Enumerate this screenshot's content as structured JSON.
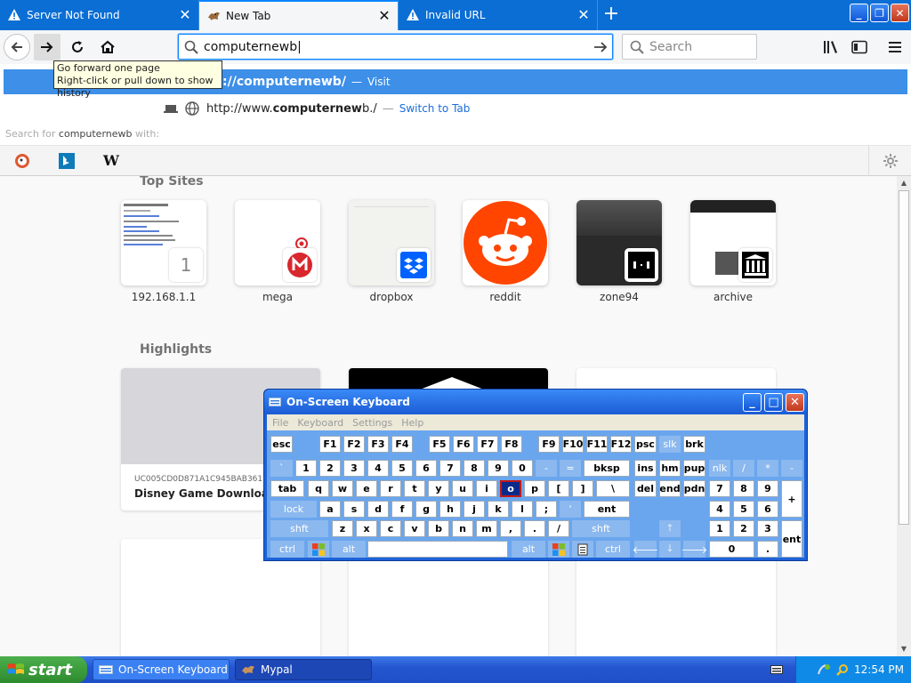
{
  "tabs": [
    {
      "title": "Server Not Found",
      "icon": "warning-icon",
      "active": false
    },
    {
      "title": "New Tab",
      "icon": "mypal-icon",
      "active": true
    },
    {
      "title": "Invalid URL",
      "icon": "warning-icon",
      "active": false
    }
  ],
  "urlbar": {
    "value": "computernewb|"
  },
  "searchbar": {
    "placeholder": "Search"
  },
  "tooltip": {
    "line1": "Go forward one page",
    "line2": "Right-click or pull down to show history"
  },
  "dropdown": {
    "row1_url": "://computernewb/",
    "row1_sep": "—",
    "row1_action": "Visit",
    "row2_url_prefix": "http://www.",
    "row2_url_bold": "computernew",
    "row2_url_suffix": "b./",
    "row2_sep": "—",
    "row2_action": "Switch to Tab",
    "search_for_prefix": "Search for",
    "search_for_term": "computernewb",
    "search_for_suffix": "with:",
    "engines": [
      "duckduckgo-icon",
      "bing-icon",
      "wikipedia-icon"
    ]
  },
  "top_sites": {
    "title": "Top Sites",
    "sites": [
      {
        "label": "192.168.1.1",
        "badge": "1"
      },
      {
        "label": "mega"
      },
      {
        "label": "dropbox"
      },
      {
        "label": "reddit"
      },
      {
        "label": "zone94"
      },
      {
        "label": "archive"
      }
    ]
  },
  "highlights": {
    "title": "Highlights",
    "card1_id": "UC005CD0D871A1C945BAB3617D",
    "card1_title": "Disney Game Downloads.z"
  },
  "osk": {
    "title": "On-Screen Keyboard",
    "menu": [
      "File",
      "Keyboard",
      "Settings",
      "Help"
    ],
    "row1": [
      "esc",
      "F1",
      "F2",
      "F3",
      "F4",
      "F5",
      "F6",
      "F7",
      "F8",
      "F9",
      "F10",
      "F11",
      "F12",
      "psc",
      "slk",
      "brk"
    ],
    "row2": [
      "`",
      "1",
      "2",
      "3",
      "4",
      "5",
      "6",
      "7",
      "8",
      "9",
      "0",
      "-",
      "=",
      "bksp",
      "ins",
      "hm",
      "pup",
      "nlk",
      "/",
      "*",
      "-"
    ],
    "row3": [
      "tab",
      "q",
      "w",
      "e",
      "r",
      "t",
      "y",
      "u",
      "i",
      "o",
      "p",
      "[",
      "]",
      "\\",
      "del",
      "end",
      "pdn",
      "7",
      "8",
      "9",
      "+"
    ],
    "row4": [
      "lock",
      "a",
      "s",
      "d",
      "f",
      "g",
      "h",
      "j",
      "k",
      "l",
      ";",
      "'",
      "ent",
      "4",
      "5",
      "6"
    ],
    "row5": [
      "shft",
      "z",
      "x",
      "c",
      "v",
      "b",
      "n",
      "m",
      ",",
      ".",
      "/",
      "shft",
      "1",
      "2",
      "3",
      "ent"
    ],
    "row6": [
      "ctrl",
      "alt",
      "alt",
      "ctrl",
      "0",
      "."
    ]
  },
  "taskbar": {
    "start": "start",
    "tasks": [
      {
        "label": "On-Screen Keyboard",
        "icon": "keyboard-icon"
      },
      {
        "label": "Mypal",
        "icon": "mypal-icon"
      }
    ],
    "clock": "12:54 PM"
  }
}
